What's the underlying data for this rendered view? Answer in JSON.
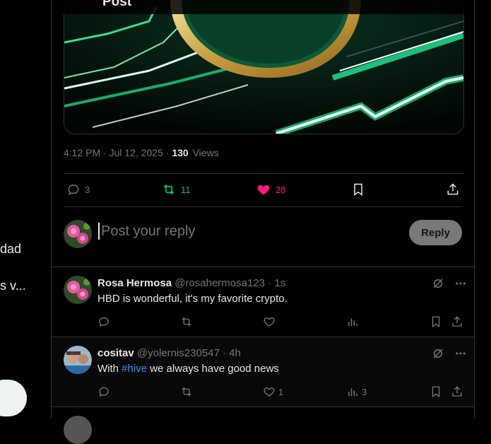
{
  "left": {
    "line1": "dad",
    "line2": "s v..."
  },
  "header": {
    "title": "Post"
  },
  "post": {
    "time": "4:12 PM",
    "date": "Jul 12, 2025",
    "views_count": "130",
    "views_label": "Views",
    "replies": "3",
    "reposts": "11",
    "likes": "28"
  },
  "reply_box": {
    "placeholder": "Post your reply",
    "button": "Reply"
  },
  "replies": [
    {
      "name": "Rosa Hermosa",
      "handle": "@rosahermosa123",
      "time": "1s",
      "text": "HBD is wonderful, it's my favorite crypto.",
      "likes": "",
      "views": ""
    },
    {
      "name": "cositav",
      "handle": "@yolernis230547",
      "time": "4h",
      "text_prefix": "With ",
      "hashtag": "#hive",
      "text_suffix": " we always have good news",
      "likes": "1",
      "views": "3"
    }
  ],
  "colors": {
    "repost": "#00ba7c",
    "like": "#f91880",
    "link": "#1d9bf0"
  }
}
